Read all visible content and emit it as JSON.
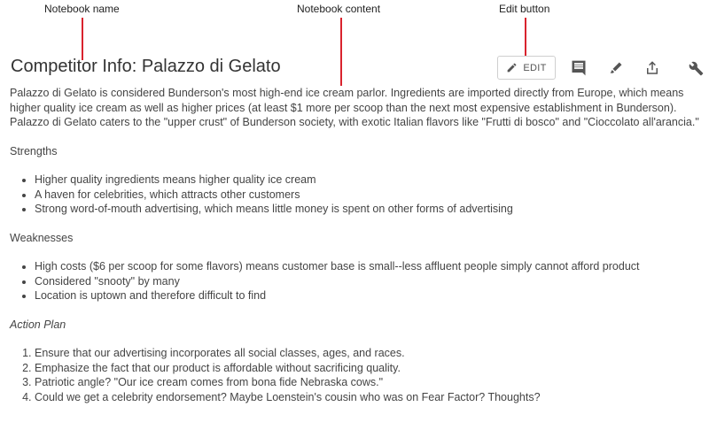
{
  "callouts": {
    "notebook_name": "Notebook name",
    "notebook_content": "Notebook content",
    "edit_button": "Edit button"
  },
  "header": {
    "title": "Competitor Info: Palazzo di Gelato",
    "edit_label": "EDIT",
    "icons": [
      "pencil-icon",
      "comment-icon",
      "highlighter-icon",
      "share-icon",
      "wrench-icon"
    ]
  },
  "content": {
    "intro": "Palazzo di Gelato is considered Bunderson's most high-end ice cream parlor. Ingredients are imported directly from Europe, which means higher quality ice cream as well as higher prices (at least $1 more per scoop than the next most expensive establishment in Bunderson). Palazzo di Gelato caters to the \"upper crust\" of Bunderson society, with exotic Italian flavors like \"Frutti di bosco\" and \"Cioccolato all'arancia.\"",
    "strengths_heading": "Strengths",
    "strengths": [
      "Higher quality ingredients means higher quality ice cream",
      "A haven for celebrities, which attracts other customers",
      "Strong word-of-mouth advertising, which means little money is spent on other forms of advertising"
    ],
    "weaknesses_heading": "Weaknesses",
    "weaknesses": [
      "High costs ($6 per scoop for some flavors) means customer base is small--less affluent people simply cannot afford product",
      "Considered \"snooty\" by many",
      "Location is uptown and therefore difficult to find"
    ],
    "action_plan_heading": "Action Plan",
    "action_plan": [
      "Ensure that our advertising incorporates all social classes, ages, and races.",
      "Emphasize the fact that our product is affordable without sacrificing quality.",
      "Patriotic angle? \"Our ice cream comes from bona fide Nebraska cows.\"",
      "Could we get a celebrity endorsement? Maybe Loenstein's cousin who was on Fear Factor? Thoughts?"
    ]
  },
  "colors": {
    "callout_line": "#d9232e",
    "text": "#444444",
    "icon": "#555555"
  }
}
